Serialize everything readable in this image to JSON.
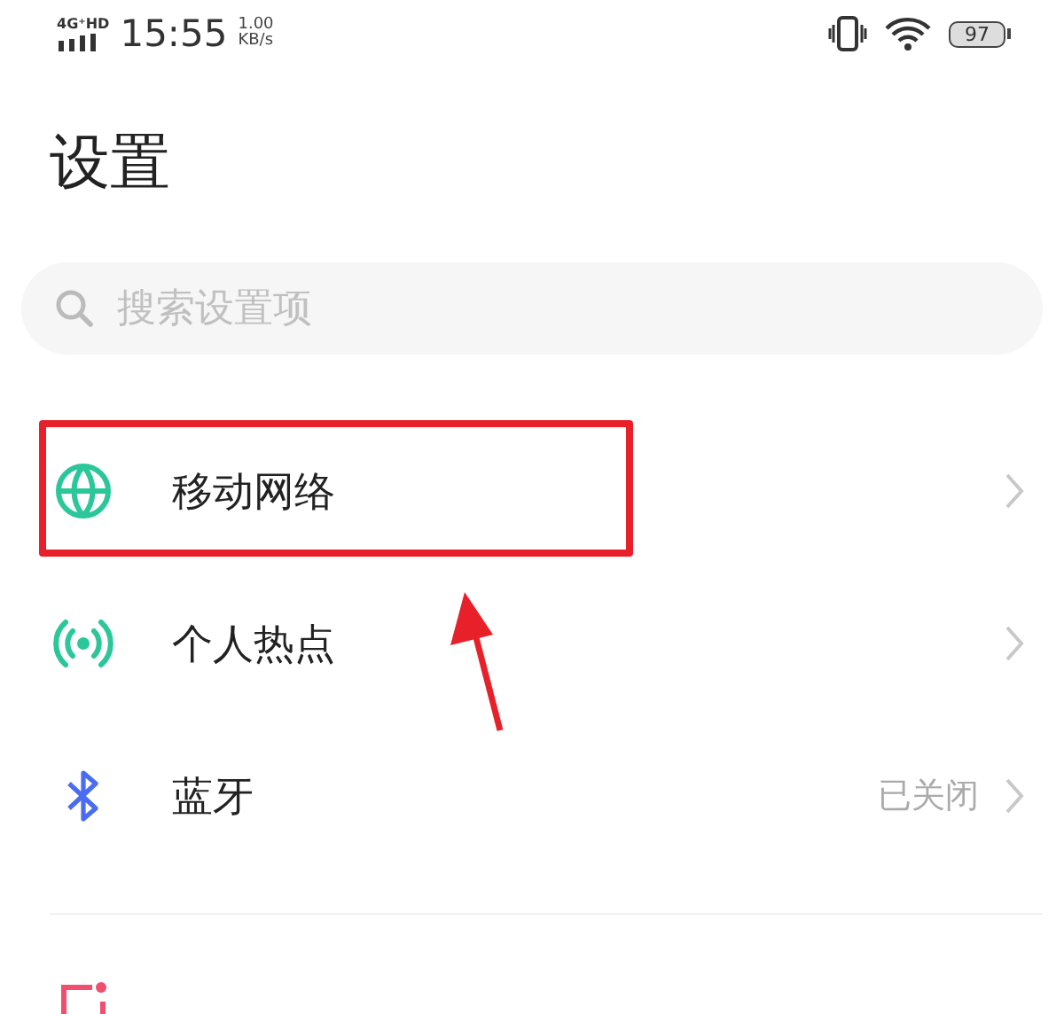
{
  "status_bar": {
    "network": "4G⁺HD",
    "time": "15:55",
    "speed_value": "1.00",
    "speed_unit": "KB/s",
    "battery": "97"
  },
  "title": "设置",
  "search": {
    "placeholder": "搜索设置项"
  },
  "items": [
    {
      "kind": "globe",
      "label": "移动网络",
      "highlighted": true
    },
    {
      "kind": "hotspot",
      "label": "个人热点",
      "highlighted": false
    },
    {
      "kind": "bluetooth",
      "label": "蓝牙",
      "value": "已关闭",
      "highlighted": false
    }
  ],
  "next_items": [
    {
      "kind": "statusbar"
    }
  ]
}
